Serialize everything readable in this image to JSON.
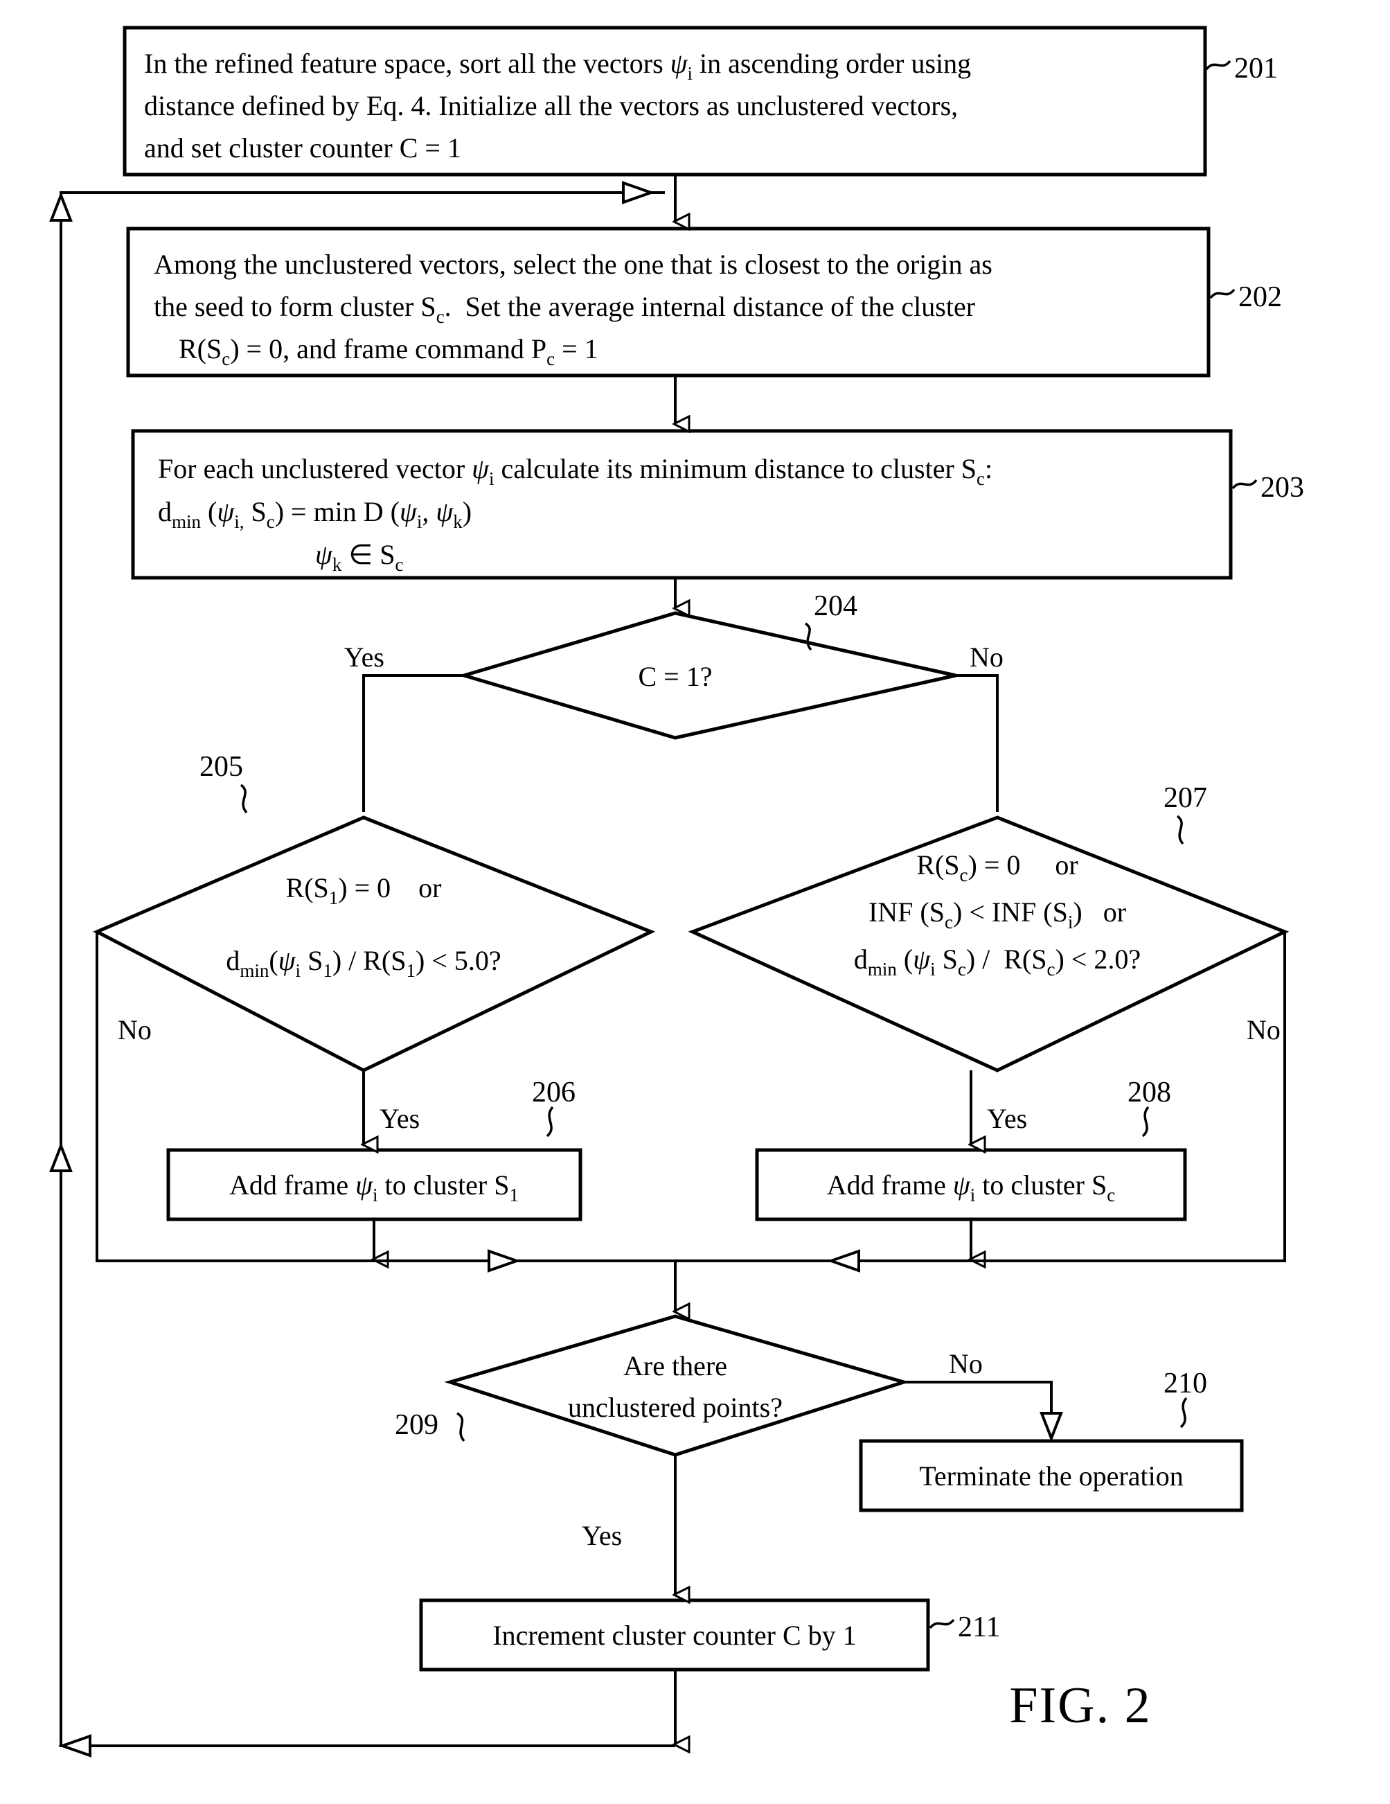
{
  "figure": {
    "caption": "FIG. 2",
    "title": "Clustering algorithm flowchart"
  },
  "nodes": {
    "n201": {
      "ref": "201",
      "type": "process",
      "lines": [
        "In the refined feature space, sort all the vectors ψi in ascending order using",
        "distance defined by Eq. 4.  Initialize all the vectors as unclustered vectors,",
        "and set cluster counter C = 1"
      ]
    },
    "n202": {
      "ref": "202",
      "type": "process",
      "lines": [
        "Among the unclustered vectors, select the one that is closest to the origin as",
        "the seed to form cluster Sc.  Set the average internal distance of the cluster",
        "R(Sc) = 0, and frame command Pc = 1"
      ]
    },
    "n203": {
      "ref": "203",
      "type": "process",
      "lines": [
        "For each unclustered vector ψi calculate its minimum distance to cluster Sc:",
        "dmin (ψi, Sc) = min D (ψi, ψk)",
        "ψk ∈ Sc"
      ]
    },
    "n204": {
      "ref": "204",
      "type": "decision",
      "lines": [
        "C = 1?"
      ],
      "yes_label": "Yes",
      "no_label": "No"
    },
    "n205": {
      "ref": "205",
      "type": "decision",
      "lines": [
        "R(S1) = 0     or",
        "dmin(ψi S1) / R(S1) < 5.0?"
      ],
      "yes_label": "Yes",
      "no_label": "No"
    },
    "n206": {
      "ref": "206",
      "type": "process",
      "lines": [
        "Add frame ψi to cluster S1"
      ]
    },
    "n207": {
      "ref": "207",
      "type": "decision",
      "lines": [
        "R(Sc) = 0      or",
        "INF (Sc) < INF (Si)   or",
        "dmin (ψi Sc) /  R(Sc) < 2.0?"
      ],
      "yes_label": "Yes",
      "no_label": "No"
    },
    "n208": {
      "ref": "208",
      "type": "process",
      "lines": [
        "Add frame ψi to cluster Sc"
      ]
    },
    "n209": {
      "ref": "209",
      "type": "decision",
      "lines": [
        "Are there",
        "unclustered points?"
      ],
      "yes_label": "Yes",
      "no_label": "No"
    },
    "n210": {
      "ref": "210",
      "type": "process",
      "lines": [
        "Terminate the operation"
      ]
    },
    "n211": {
      "ref": "211",
      "type": "process",
      "lines": [
        "Increment cluster counter C by 1"
      ]
    }
  },
  "edge_labels": {
    "d204_yes": "Yes",
    "d204_no": "No",
    "d205_no": "No",
    "d205_yes": "Yes",
    "d207_no": "No",
    "d207_yes": "Yes",
    "d209_no": "No",
    "d209_yes": "Yes"
  }
}
